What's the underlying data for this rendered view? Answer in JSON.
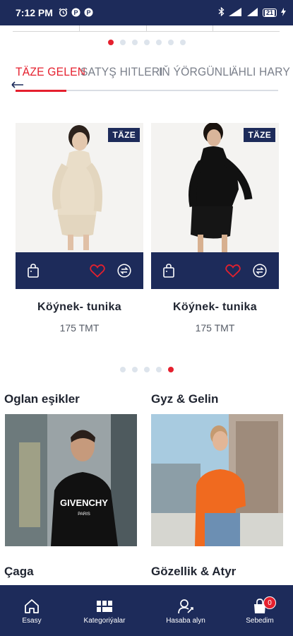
{
  "status_bar": {
    "time": "7:12 PM",
    "icons_left": [
      "alarm-icon",
      "p-app-icon",
      "p-app-icon"
    ],
    "icons_right": [
      "bluetooth-icon",
      "signal-icon",
      "signal-icon",
      "battery-icon"
    ],
    "battery_level": "21"
  },
  "top_carousel": {
    "dots": 7,
    "active_index": 0
  },
  "tabs": [
    {
      "label": "TÄZE GELEN",
      "active": true
    },
    {
      "label": "SATYŞ HITLERI",
      "active": false
    },
    {
      "label": "IŇ ÝÖRGÜNLI",
      "active": false
    },
    {
      "label": "ÄHLI HARY",
      "active": false
    }
  ],
  "products": [
    {
      "badge": "TÄZE",
      "name": "Köýnek- tunika",
      "price": "175 TMT",
      "color": "#e9ddc8"
    },
    {
      "badge": "TÄZE",
      "name": "Köýnek- tunika",
      "price": "175 TMT",
      "color": "#111111"
    }
  ],
  "products_carousel": {
    "dots": 5,
    "active_index": 4
  },
  "categories": [
    {
      "title": "Oglan eşikler"
    },
    {
      "title": "Gyz & Gelin"
    },
    {
      "title": "Çaga"
    },
    {
      "title": "Gözellik & Atyr"
    }
  ],
  "bottom_nav": {
    "items": [
      {
        "label": "Esasy",
        "icon": "home-icon"
      },
      {
        "label": "Kategoriýalar",
        "icon": "categories-icon"
      },
      {
        "label": "Hasaba alyn",
        "icon": "add-user-icon"
      },
      {
        "label": "Sebedim",
        "icon": "cart-icon"
      }
    ],
    "cart_count": "0"
  },
  "colors": {
    "primary": "#1d2b5a",
    "accent": "#e5202e"
  }
}
